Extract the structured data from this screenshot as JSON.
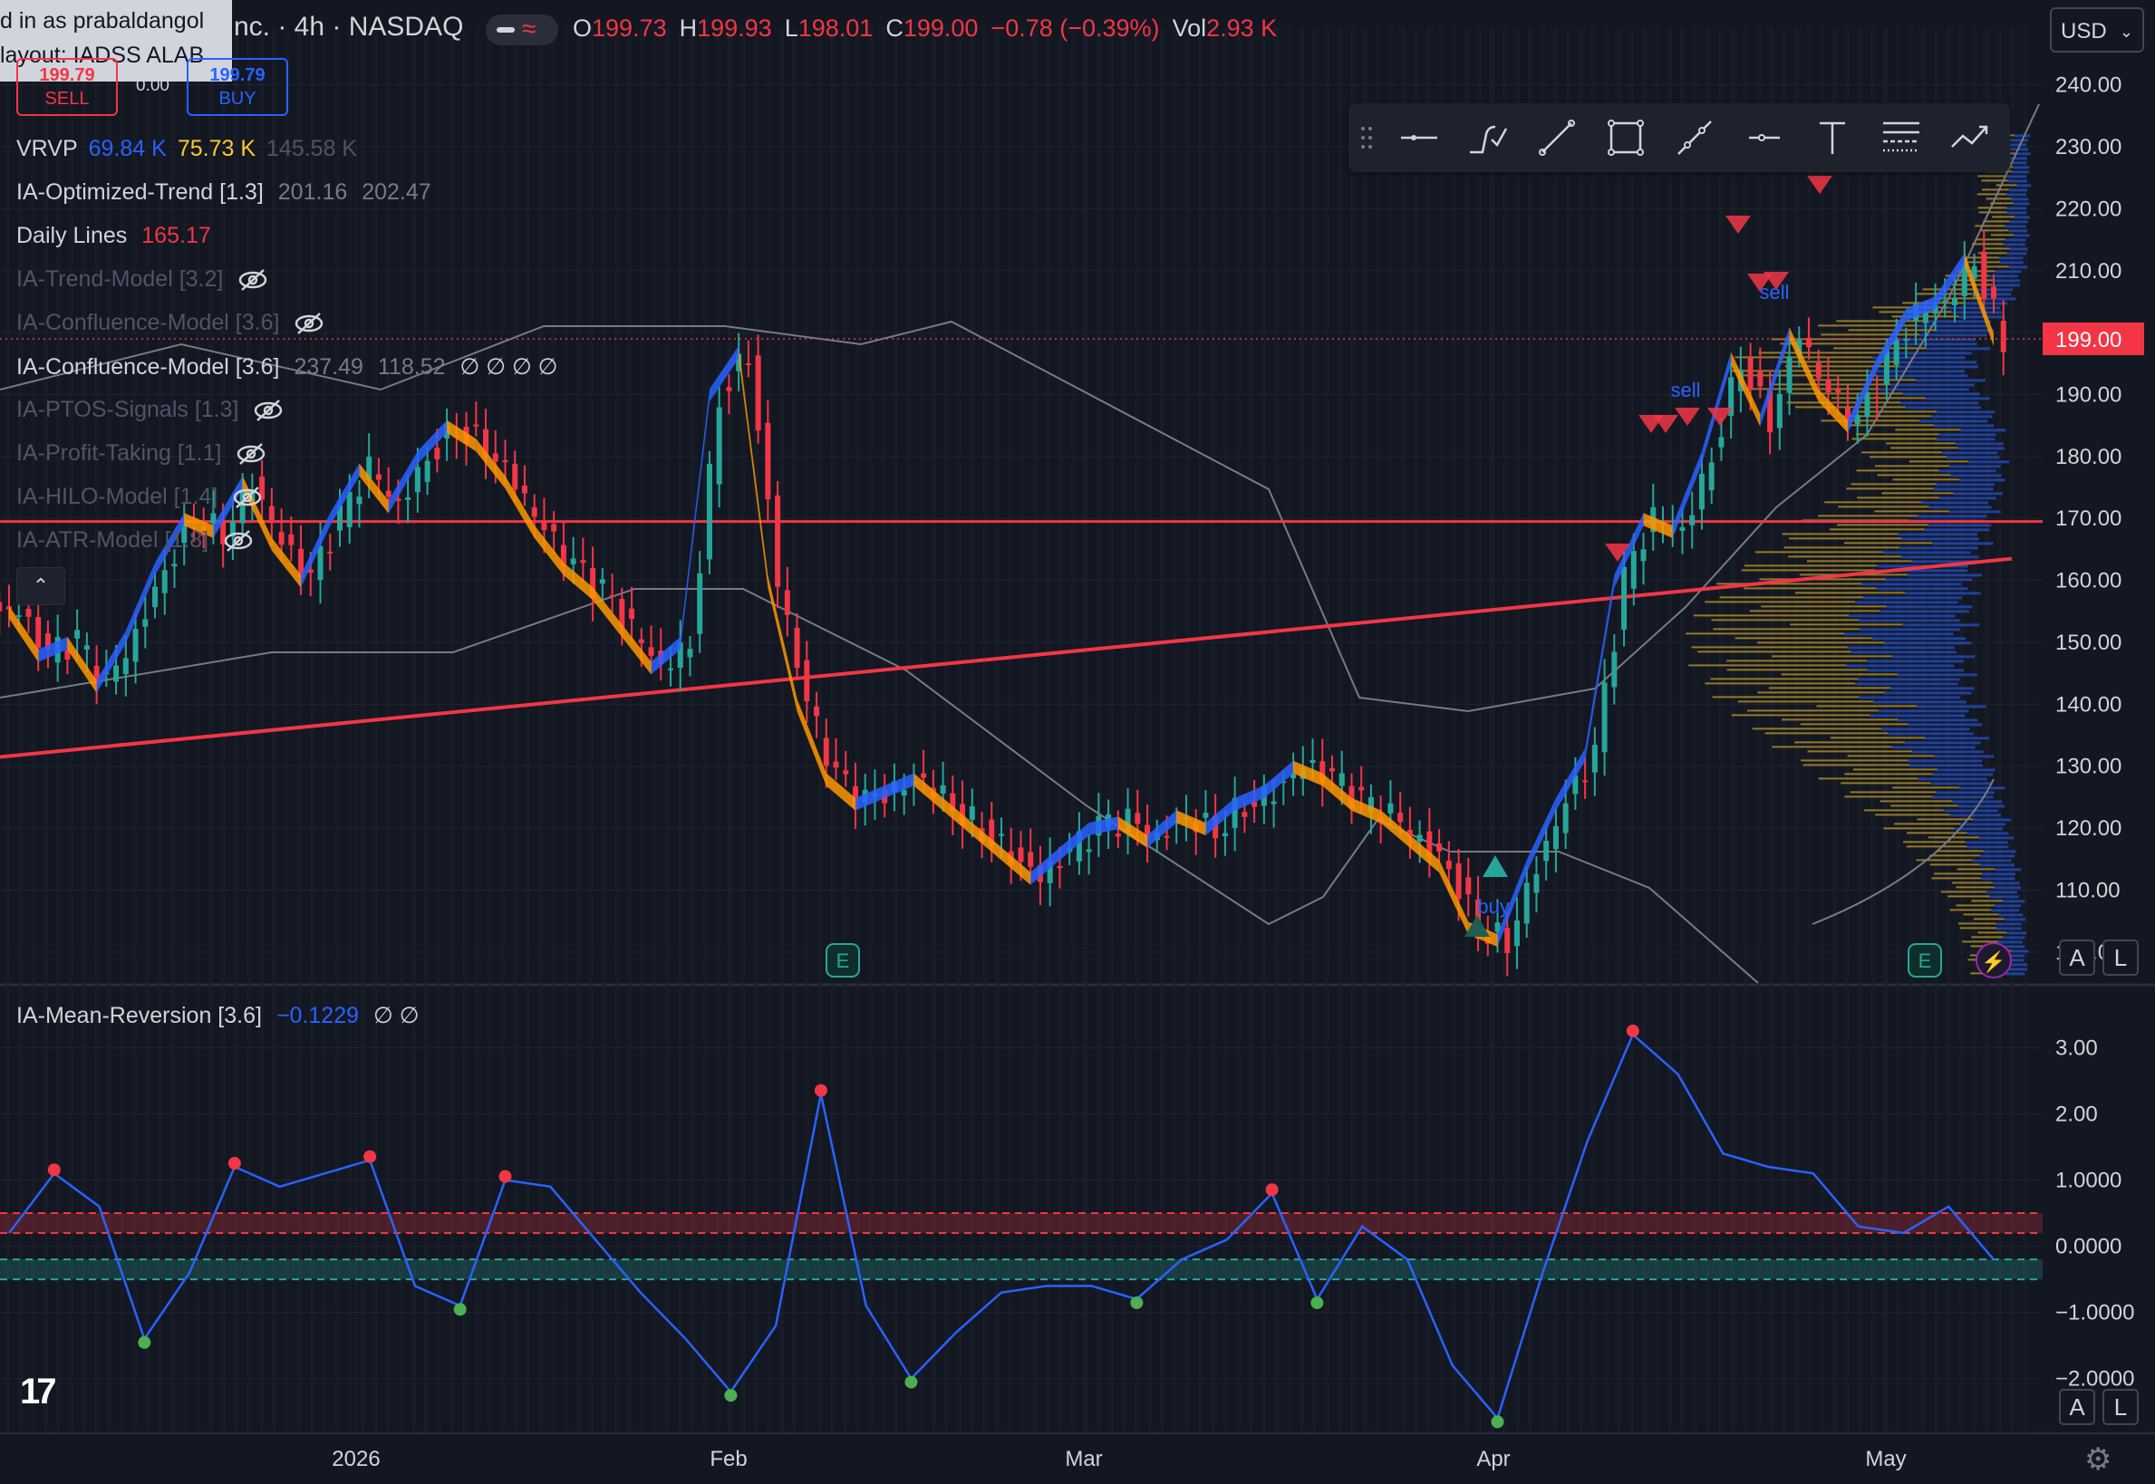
{
  "tooltip": {
    "line1": "d in as prabaldangol",
    "line2": "layout: IADSS ALAB"
  },
  "header": {
    "symbol": "nc. · 4h · NASDAQ",
    "ohlc": [
      {
        "k": "O",
        "v": "199.73"
      },
      {
        "k": "H",
        "v": "199.93"
      },
      {
        "k": "L",
        "v": "198.01"
      },
      {
        "k": "C",
        "v": "199.00"
      }
    ],
    "change": "−0.78 (−0.39%)",
    "vol_label": "Vol",
    "vol_value": "2.93 K",
    "currency": "USD"
  },
  "trade": {
    "sell_price": "199.79",
    "sell_label": "SELL",
    "spread": "0.00",
    "buy_price": "199.79",
    "buy_label": "BUY"
  },
  "legend": {
    "vrvp": {
      "name": "VRVP",
      "v1": "69.84 K",
      "v2": "75.73 K",
      "v3": "145.58 K"
    },
    "trend": {
      "name": "IA-Optimized-Trend [1.3]",
      "v1": "201.16",
      "v2": "202.47"
    },
    "daily": {
      "name": "Daily Lines",
      "v1": "165.17"
    },
    "hidden1": "IA-Trend-Model [3.2]",
    "hidden2": "IA-Confluence-Model [3.6]",
    "confluence": {
      "name": "IA-Confluence-Model [3.6]",
      "v1": "237.49",
      "v2": "118.52",
      "v3": "∅ ∅ ∅ ∅"
    },
    "hidden3": "IA-PTOS-Signals [1.3]",
    "hidden4": "IA-Profit-Taking [1.1]",
    "hidden5": "IA-HILO-Model [1.4]",
    "hidden6": "IA-ATR-Model [1.8]"
  },
  "lower_legend": {
    "name": "IA-Mean-Reversion [3.6]",
    "value": "−0.1229",
    "extra": "∅ ∅"
  },
  "signals": {
    "sell1": "sell",
    "sell2": "sell",
    "buy1": "buy",
    "earnings": "E"
  },
  "price_label": "199.00",
  "time_axis": [
    "2026",
    "Feb",
    "Mar",
    "Apr",
    "May"
  ],
  "scale_buttons": {
    "auto": "A",
    "log": "L"
  },
  "colors": {
    "bg": "#131722",
    "up": "#26a69a",
    "down": "#f23645",
    "accent_blue": "#2962ff",
    "orange": "#ff9800",
    "red_line": "#f23645"
  },
  "chart_data": [
    {
      "type": "candlestick",
      "title": "",
      "ylim": [
        95,
        242
      ],
      "y_ticks": [
        100,
        110,
        120,
        130,
        140,
        150,
        160,
        170,
        180,
        190,
        200,
        210,
        220,
        230,
        240
      ],
      "x_labels": [
        "2026",
        "Feb",
        "Mar",
        "Apr",
        "May"
      ],
      "series": [
        {
          "name": "close_approx",
          "values": [
            155,
            148,
            150,
            143,
            151,
            162,
            170,
            168,
            176,
            166,
            160,
            170,
            178,
            172,
            180,
            185,
            182,
            176,
            168,
            162,
            158,
            152,
            146,
            150,
            190,
            197,
            160,
            140,
            128,
            124,
            126,
            128,
            124,
            120,
            116,
            112,
            116,
            120,
            121,
            118,
            122,
            120,
            124,
            126,
            130,
            128,
            124,
            122,
            118,
            114,
            104,
            102,
            114,
            124,
            132,
            160,
            170,
            168,
            180,
            196,
            186,
            200,
            190,
            185,
            195,
            203,
            205,
            212,
            199
          ]
        }
      ],
      "horizontal_lines": [
        {
          "value": 169.5
        }
      ],
      "last_price": 199.0
    },
    {
      "type": "line",
      "title": "",
      "ylim": [
        -2.8,
        3.5
      ],
      "y_ticks": [
        3.0,
        2.0,
        1.0,
        0.0,
        -1.0,
        -2.0
      ],
      "series": [
        {
          "values": [
            0.2,
            1.1,
            0.6,
            -1.4,
            -0.4,
            1.2,
            0.9,
            1.1,
            1.3,
            -0.6,
            -0.9,
            1.0,
            0.9,
            0.1,
            -0.7,
            -1.4,
            -2.2,
            -1.2,
            2.3,
            -0.9,
            -2.0,
            -1.3,
            -0.7,
            -0.6,
            -0.6,
            -0.8,
            -0.2,
            0.1,
            0.8,
            -0.8,
            0.3,
            -0.2,
            -1.8,
            -2.6,
            -0.4,
            1.6,
            3.2,
            2.6,
            1.4,
            1.2,
            1.1,
            0.3,
            0.2,
            0.6,
            -0.2
          ]
        }
      ],
      "bands": [
        {
          "from": 0.2,
          "to": 0.5
        },
        {
          "from": -0.5,
          "to": -0.2
        }
      ]
    }
  ]
}
